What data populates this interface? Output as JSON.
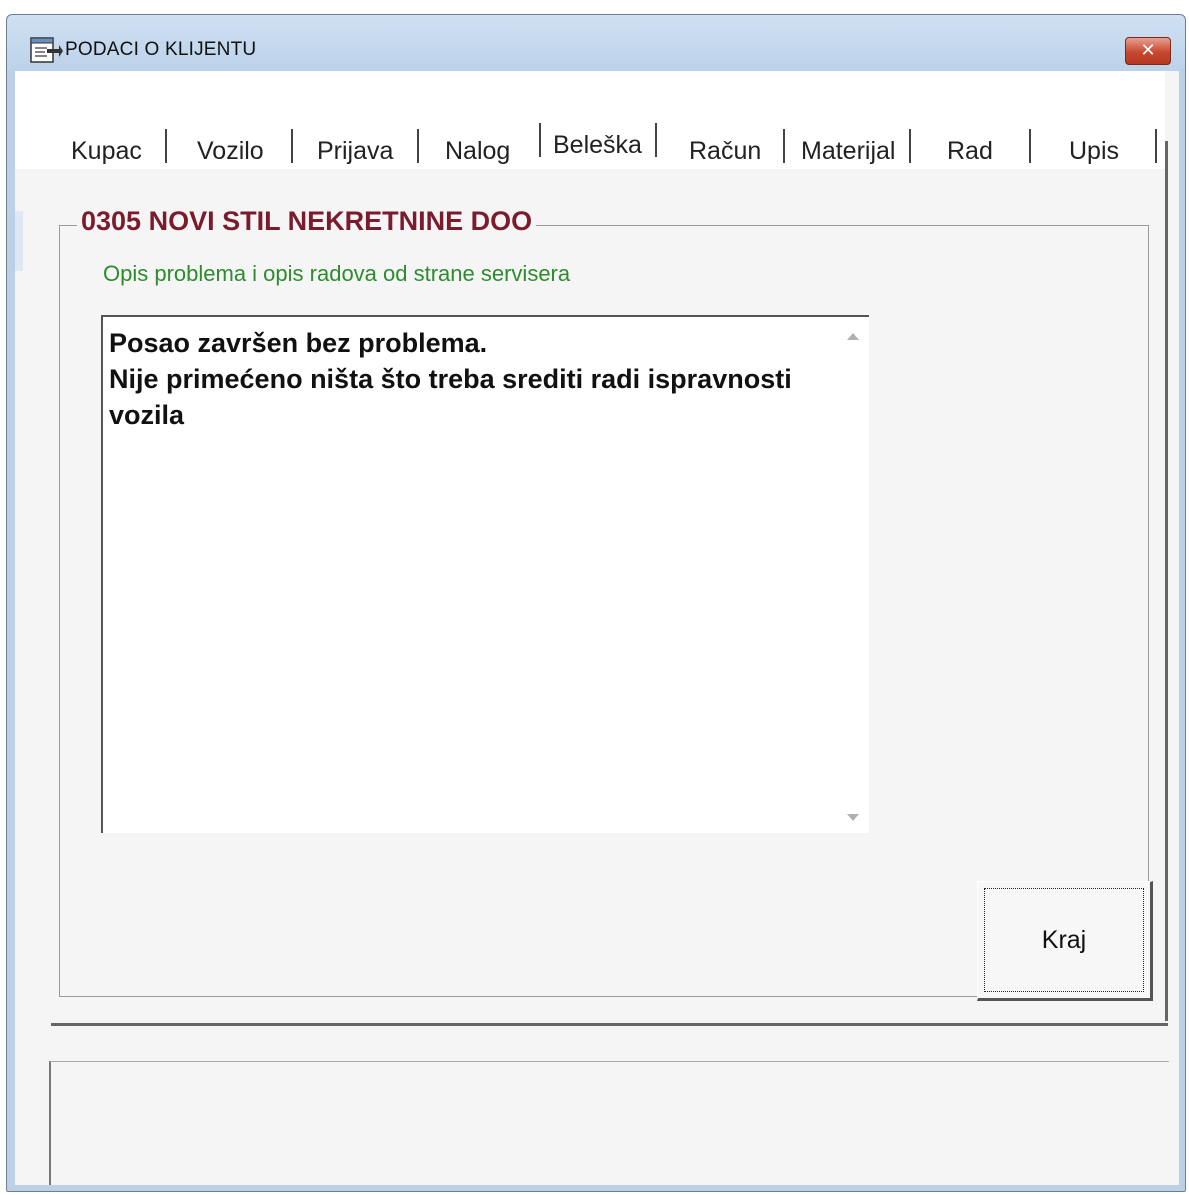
{
  "window": {
    "title": "PODACI O KLIJENTU",
    "close_label": "✕"
  },
  "tabs": [
    {
      "label": "Kupac",
      "active": false
    },
    {
      "label": "Vozilo",
      "active": false
    },
    {
      "label": "Prijava",
      "active": false
    },
    {
      "label": "Nalog",
      "active": false
    },
    {
      "label": "Beleška",
      "active": true
    },
    {
      "label": "Račun",
      "active": false
    },
    {
      "label": "Materijal",
      "active": false
    },
    {
      "label": "Rad",
      "active": false
    },
    {
      "label": "Upis",
      "active": false
    }
  ],
  "group": {
    "title": "0305 NOVI STIL NEKRETNINE DOO",
    "subtitle": "Opis problema i opis radova od strane servisera",
    "note_text": "Posao završen bez problema.\nNije primećeno ništa što treba srediti radi ispravnosti\nvozila"
  },
  "buttons": {
    "kraj_label": "Kraj"
  },
  "colors": {
    "group_title": "#7a1c2e",
    "subtitle": "#2e8b2e",
    "titlebar": "#bcd2ea",
    "close_button": "#c8472e"
  },
  "icons": {
    "window_icon": "form-icon",
    "close": "close-icon"
  }
}
